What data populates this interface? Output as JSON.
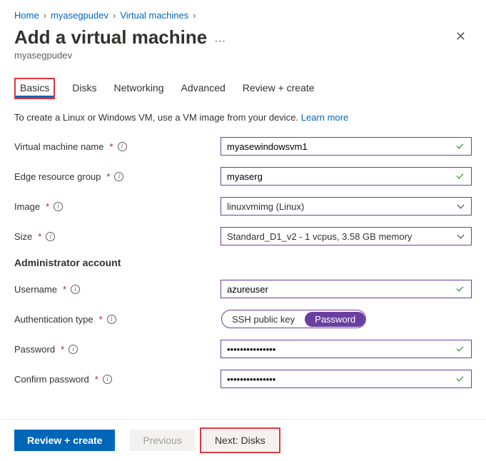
{
  "breadcrumb": {
    "home": "Home",
    "resource": "myasegpudev",
    "section": "Virtual machines"
  },
  "header": {
    "title": "Add a virtual machine",
    "subtitle": "myasegpudev"
  },
  "tabs": {
    "basics": "Basics",
    "disks": "Disks",
    "networking": "Networking",
    "advanced": "Advanced",
    "review": "Review + create",
    "active": "basics"
  },
  "help": {
    "text": "To create a Linux or Windows VM, use a VM image from your device.",
    "link": "Learn more"
  },
  "fields": {
    "vmname": {
      "label": "Virtual machine name",
      "value": "myasewindowsvm1"
    },
    "erg": {
      "label": "Edge resource group",
      "value": "myaserg"
    },
    "image": {
      "label": "Image",
      "value": "linuxvmimg (Linux)"
    },
    "size": {
      "label": "Size",
      "value": "Standard_D1_v2 - 1 vcpus, 3.58 GB memory"
    }
  },
  "admin": {
    "section": "Administrator account",
    "username": {
      "label": "Username",
      "value": "azureuser"
    },
    "authtype": {
      "label": "Authentication type",
      "ssh": "SSH public key",
      "password": "Password",
      "selected": "password"
    },
    "password": {
      "label": "Password",
      "value": "●●●●●●●●●●●●●●●"
    },
    "cpassword": {
      "label": "Confirm password",
      "value": "●●●●●●●●●●●●●●●"
    }
  },
  "footer": {
    "review": "Review + create",
    "previous": "Previous",
    "next": "Next: Disks"
  }
}
